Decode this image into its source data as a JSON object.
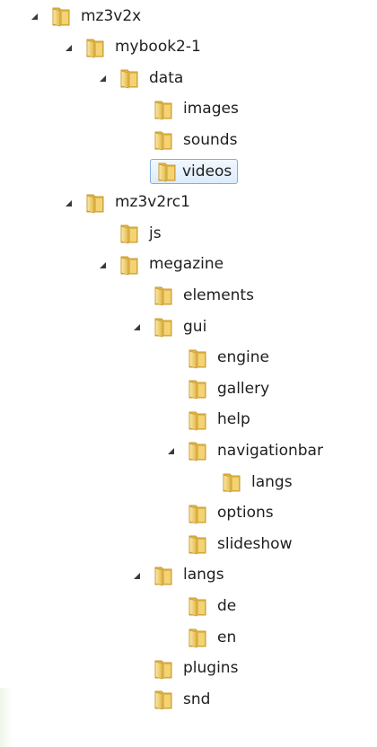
{
  "tree": {
    "nodes": [
      {
        "label": "mz3v2x",
        "depth": 0,
        "expanded": true
      },
      {
        "label": "mybook2-1",
        "depth": 1,
        "expanded": true
      },
      {
        "label": "data",
        "depth": 2,
        "expanded": true
      },
      {
        "label": "images",
        "depth": 3
      },
      {
        "label": "sounds",
        "depth": 3
      },
      {
        "label": "videos",
        "depth": 3,
        "selected": true
      },
      {
        "label": "mz3v2rc1",
        "depth": 1,
        "expanded": true
      },
      {
        "label": "js",
        "depth": 2
      },
      {
        "label": "megazine",
        "depth": 2,
        "expanded": true
      },
      {
        "label": "elements",
        "depth": 3
      },
      {
        "label": "gui",
        "depth": 3,
        "expanded": true
      },
      {
        "label": "engine",
        "depth": 4
      },
      {
        "label": "gallery",
        "depth": 4
      },
      {
        "label": "help",
        "depth": 4
      },
      {
        "label": "navigationbar",
        "depth": 4,
        "expanded": true
      },
      {
        "label": "langs",
        "depth": 5
      },
      {
        "label": "options",
        "depth": 4
      },
      {
        "label": "slideshow",
        "depth": 4
      },
      {
        "label": "langs",
        "depth": 3,
        "expanded": true
      },
      {
        "label": "de",
        "depth": 4
      },
      {
        "label": "en",
        "depth": 4
      },
      {
        "label": "plugins",
        "depth": 3
      },
      {
        "label": "snd",
        "depth": 3
      }
    ]
  },
  "icons": {
    "folder": "folder-icon",
    "expanded_arrow": "expanded-arrow-icon"
  },
  "colors": {
    "folder_light": "#fbe9a7",
    "folder_dark": "#e2b84b",
    "folder_edge": "#c99a2e",
    "selection_border": "#84acdd",
    "selection_fill": "#dcecfc",
    "arrow": "#3a3a3a"
  }
}
